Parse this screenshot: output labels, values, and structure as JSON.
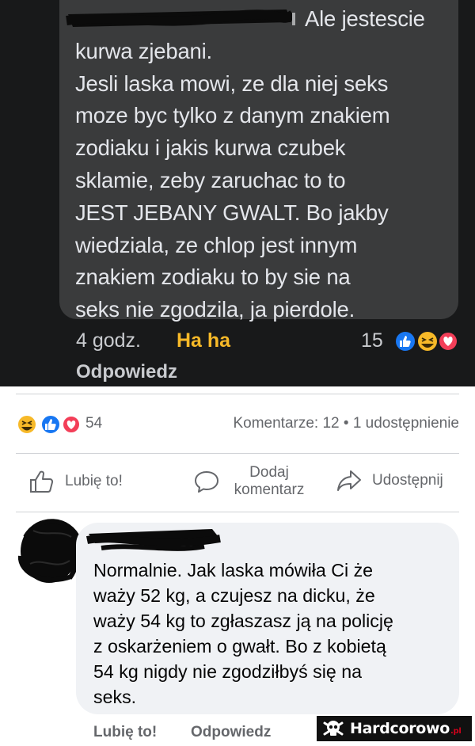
{
  "dark_comment": {
    "first_line_suffix": "Ale jestescie",
    "lines": [
      "kurwa zjebani.",
      "Jesli laska mowi, ze dla niej seks",
      "moze byc tylko z danym znakiem",
      "zodiaku i jakis kurwa czubek",
      "sklamie, zeby zaruchac to to",
      "JEST JEBANY GWALT. Bo jakby",
      "wiedziala, ze chlop jest innym",
      "znakiem zodiaku to by sie na",
      "seks nie zgodzila, ja pierdole."
    ],
    "time": "4 godz.",
    "haha": "Ha ha",
    "reaction_count": "15",
    "reply": "Odpowiedz"
  },
  "post_stats": {
    "reaction_count": "54",
    "comments_shares": "Komentarze: 12 • 1 udostępnienie"
  },
  "actions": {
    "like": "Lubię to!",
    "comment_line1": "Dodaj",
    "comment_line2": "komentarz",
    "share": "Udostępnij"
  },
  "comment": {
    "lines": [
      "Normalnie. Jak laska mówiła Ci że",
      "waży 52 kg, a czujesz na dicku, że",
      "waży 54 kg to zgłaszasz ją na policję",
      "z oskarżeniem o gwałt. Bo z kobietą",
      "54 kg nigdy nie zgodziłbyś się na",
      "seks."
    ],
    "like": "Lubię to!",
    "reply": "Odpowiedz"
  },
  "watermark": {
    "text": "Hardcorowo",
    "suffix": ".pl"
  },
  "colors": {
    "dark_bg": "#18191a",
    "dark_bubble": "#3a3b3c",
    "haha_yellow": "#f7b928",
    "like_blue": "#1877f2",
    "love_red": "#f33e58",
    "light_bubble": "#f0f2f5"
  },
  "icons": {
    "like_action": "thumbs-up-outline-icon",
    "comment_action": "speech-bubble-icon",
    "share_action": "share-arrow-icon",
    "reactions": [
      "haha-emoji-icon",
      "like-icon",
      "love-icon"
    ]
  }
}
